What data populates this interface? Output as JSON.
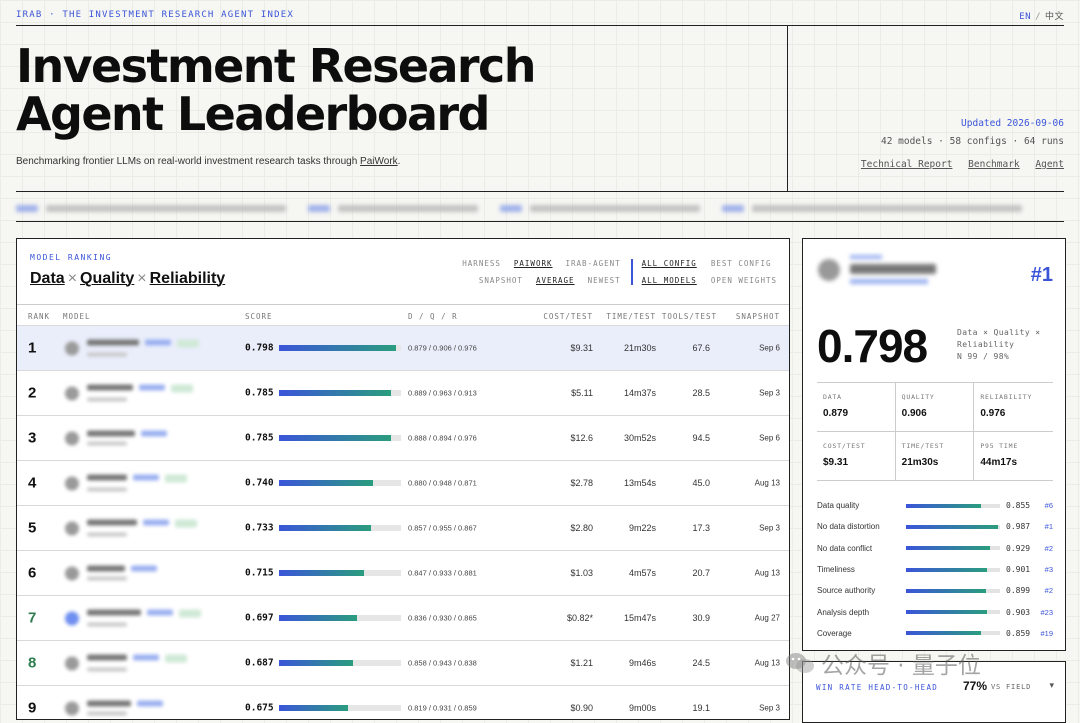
{
  "topbar": {
    "title": "IRAB · THE INVESTMENT RESEARCH AGENT INDEX",
    "lang_en": "EN",
    "lang_sep": "/",
    "lang_zh": "中文"
  },
  "hero": {
    "title_line1": "Investment Research",
    "title_line2": "Agent Leaderboard",
    "subtitle_prefix": "Benchmarking frontier LLMs on real-world investment research tasks through ",
    "subtitle_link": "PaiWork",
    "subtitle_suffix": ".",
    "updated": "Updated 2026-09-06",
    "counts": "42 models · 58 configs · 64 runs",
    "links": [
      "Technical Report",
      "Benchmark",
      "Agent"
    ]
  },
  "ranking": {
    "label": "MODEL RANKING",
    "title_parts": [
      "Data",
      "Quality",
      "Reliability"
    ],
    "title_sep": "×",
    "filters": {
      "harness_label": "HARNESS",
      "harness_options": [
        "PAIWORK",
        "IRAB-AGENT"
      ],
      "snapshot_label": "SNAPSHOT",
      "snapshot_options": [
        "AVERAGE",
        "NEWEST"
      ],
      "config_options": [
        "ALL CONFIG",
        "BEST CONFIG"
      ],
      "model_options": [
        "ALL MODELS",
        "OPEN WEIGHTS"
      ]
    },
    "columns": [
      "RANK",
      "MODEL",
      "SCORE",
      "D / Q / R",
      "COST/TEST",
      "TIME/TEST",
      "TOOLS/TEST",
      "SNAPSHOT"
    ],
    "rows": [
      {
        "rank": "1",
        "score": "0.798",
        "score_value": 0.798,
        "dqr": "0.879 / 0.906 / 0.976",
        "cost": "$9.31",
        "time": "21m30s",
        "tools": "67.6",
        "snapshot": "Sep 6"
      },
      {
        "rank": "2",
        "score": "0.785",
        "score_value": 0.785,
        "dqr": "0.889 / 0.963 / 0.913",
        "cost": "$5.11",
        "time": "14m37s",
        "tools": "28.5",
        "snapshot": "Sep 3"
      },
      {
        "rank": "3",
        "score": "0.785",
        "score_value": 0.785,
        "dqr": "0.888 / 0.894 / 0.976",
        "cost": "$12.6",
        "time": "30m52s",
        "tools": "94.5",
        "snapshot": "Sep 6"
      },
      {
        "rank": "4",
        "score": "0.740",
        "score_value": 0.74,
        "dqr": "0.880 / 0.948 / 0.871",
        "cost": "$2.78",
        "time": "13m54s",
        "tools": "45.0",
        "snapshot": "Aug 13"
      },
      {
        "rank": "5",
        "score": "0.733",
        "score_value": 0.733,
        "dqr": "0.857 / 0.955 / 0.867",
        "cost": "$2.80",
        "time": "9m22s",
        "tools": "17.3",
        "snapshot": "Sep 3"
      },
      {
        "rank": "6",
        "score": "0.715",
        "score_value": 0.715,
        "dqr": "0.847 / 0.933 / 0.881",
        "cost": "$1.03",
        "time": "4m57s",
        "tools": "20.7",
        "snapshot": "Aug 13"
      },
      {
        "rank": "7",
        "score": "0.697",
        "score_value": 0.697,
        "dqr": "0.836 / 0.930 / 0.865",
        "cost": "$0.82*",
        "time": "15m47s",
        "tools": "30.9",
        "snapshot": "Aug 27",
        "green": true
      },
      {
        "rank": "8",
        "score": "0.687",
        "score_value": 0.687,
        "dqr": "0.858 / 0.943 / 0.838",
        "cost": "$1.21",
        "time": "9m46s",
        "tools": "24.5",
        "snapshot": "Aug 13",
        "green": true
      },
      {
        "rank": "9",
        "score": "0.675",
        "score_value": 0.675,
        "dqr": "0.819 / 0.931 / 0.859",
        "cost": "$0.90",
        "time": "9m00s",
        "tools": "19.1",
        "snapshot": "Sep 3"
      }
    ]
  },
  "detail": {
    "rank": "#1",
    "score": "0.798",
    "score_note": [
      "Data × Quality ×",
      "Reliability",
      "N 99 / 98%"
    ],
    "stats_row1": [
      {
        "label": "DATA",
        "value": "0.879"
      },
      {
        "label": "QUALITY",
        "value": "0.906"
      },
      {
        "label": "RELIABILITY",
        "value": "0.976"
      }
    ],
    "stats_row2": [
      {
        "label": "COST/TEST",
        "value": "$9.31"
      },
      {
        "label": "TIME/TEST",
        "value": "21m30s"
      },
      {
        "label": "P95 TIME",
        "value": "44m17s"
      }
    ],
    "metrics": [
      {
        "name": "Data quality",
        "value": "0.855",
        "value_num": 0.855,
        "rank": "#6"
      },
      {
        "name": "No data distortion",
        "value": "0.987",
        "value_num": 0.987,
        "rank": "#1"
      },
      {
        "name": "No data conflict",
        "value": "0.929",
        "value_num": 0.929,
        "rank": "#2"
      },
      {
        "name": "Timeliness",
        "value": "0.901",
        "value_num": 0.901,
        "rank": "#3"
      },
      {
        "name": "Source authority",
        "value": "0.899",
        "value_num": 0.899,
        "rank": "#2"
      },
      {
        "name": "Analysis depth",
        "value": "0.903",
        "value_num": 0.903,
        "rank": "#23"
      },
      {
        "name": "Coverage",
        "value": "0.859",
        "value_num": 0.859,
        "rank": "#19"
      }
    ]
  },
  "winrate": {
    "label": "WIN RATE HEAD-TO-HEAD",
    "pct": "77%",
    "sub": "VS FIELD",
    "chevron": "▾"
  },
  "watermark": {
    "text": "公众号 · 量子位",
    "icon": "wechat-icon"
  },
  "colors": {
    "accent": "#3b55d9",
    "accent_green": "#2a9d7e",
    "highlight_row": "#eaeefb"
  }
}
